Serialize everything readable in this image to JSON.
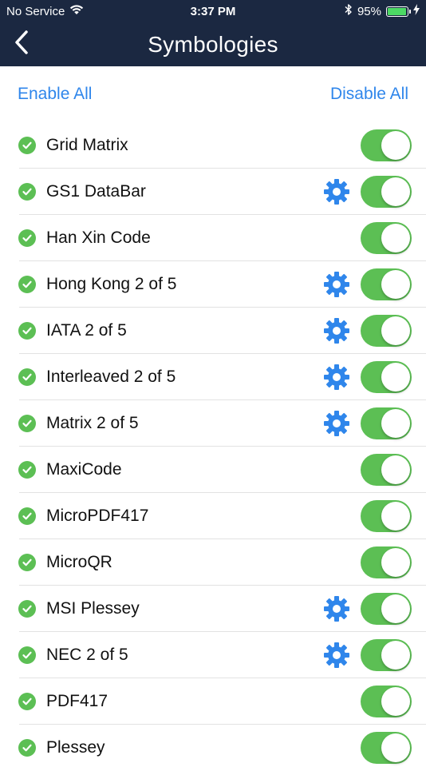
{
  "status_bar": {
    "carrier": "No Service",
    "time": "3:37 PM",
    "battery_percent": "95%",
    "battery_level": 0.95,
    "icons": [
      "wifi-icon",
      "bluetooth-icon",
      "battery-icon",
      "charging-icon"
    ]
  },
  "nav": {
    "title": "Symbologies",
    "back_icon": "chevron-left-icon"
  },
  "actions": {
    "enable_all": "Enable All",
    "disable_all": "Disable All"
  },
  "colors": {
    "nav_bg": "#1b2841",
    "accent": "#2f86eb",
    "toggle_on": "#5cbf54",
    "check": "#5cbf54"
  },
  "symbologies": [
    {
      "name": "Grid Matrix",
      "has_settings": false,
      "enabled": true
    },
    {
      "name": "GS1 DataBar",
      "has_settings": true,
      "enabled": true
    },
    {
      "name": "Han Xin Code",
      "has_settings": false,
      "enabled": true
    },
    {
      "name": "Hong Kong 2 of 5",
      "has_settings": true,
      "enabled": true
    },
    {
      "name": "IATA 2 of 5",
      "has_settings": true,
      "enabled": true
    },
    {
      "name": "Interleaved 2 of 5",
      "has_settings": true,
      "enabled": true
    },
    {
      "name": "Matrix 2 of 5",
      "has_settings": true,
      "enabled": true
    },
    {
      "name": "MaxiCode",
      "has_settings": false,
      "enabled": true
    },
    {
      "name": "MicroPDF417",
      "has_settings": false,
      "enabled": true
    },
    {
      "name": "MicroQR",
      "has_settings": false,
      "enabled": true
    },
    {
      "name": "MSI Plessey",
      "has_settings": true,
      "enabled": true
    },
    {
      "name": "NEC 2 of 5",
      "has_settings": true,
      "enabled": true
    },
    {
      "name": "PDF417",
      "has_settings": false,
      "enabled": true
    },
    {
      "name": "Plessey",
      "has_settings": false,
      "enabled": true
    }
  ]
}
